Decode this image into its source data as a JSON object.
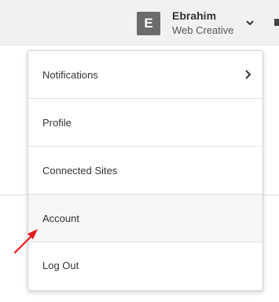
{
  "user": {
    "initial": "E",
    "name": "Ebrahim",
    "role": "Web Creative"
  },
  "menu": {
    "items": [
      {
        "label": "Notifications",
        "has_submenu": true
      },
      {
        "label": "Profile"
      },
      {
        "label": "Connected Sites"
      },
      {
        "label": "Account",
        "hovered": true
      },
      {
        "label": "Log Out"
      }
    ]
  },
  "icons": {
    "account_toggle": "chevron-down-icon",
    "submenu": "chevron-right-icon",
    "annotation": "red-arrow-icon"
  },
  "colors": {
    "topbar_bg": "#f1f1f1",
    "avatar_bg": "#6b6b6b",
    "annotation": "#e8191b"
  }
}
